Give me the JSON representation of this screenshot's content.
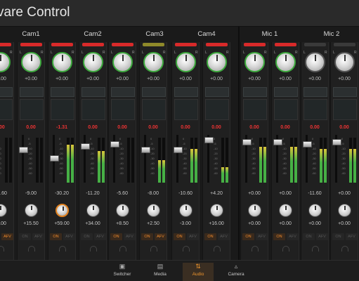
{
  "app": {
    "title": "vare Control"
  },
  "groups": [
    {
      "name": "Cam1"
    },
    {
      "name": "Cam2"
    },
    {
      "name": "Cam3"
    },
    {
      "name": "Cam4"
    },
    {
      "name": "Mic 1"
    },
    {
      "name": "Mic 2"
    }
  ],
  "strips": [
    {
      "tally": "red",
      "trim": "+0.00",
      "peak": "0.00",
      "gain": "-30.60",
      "balance": "+0.00",
      "on": "ON",
      "afv": "AFV",
      "on_active": true,
      "afv_active": true,
      "level": 0.0,
      "fader": 0.5
    },
    {
      "tally": "red",
      "trim": "+0.00",
      "peak": "0.00",
      "gain": "-9.00",
      "balance": "+15.50",
      "on": "ON",
      "afv": "AFV",
      "on_active": false,
      "afv_active": false,
      "level": 0.0,
      "fader": 0.7
    },
    {
      "tally": "red",
      "trim": "+0.00",
      "peak": "-1.31",
      "gain": "-30.20",
      "balance": "+59.00",
      "on": "ON",
      "afv": "AFV",
      "on_active": true,
      "afv_active": false,
      "level": 0.85,
      "fader": 0.5
    },
    {
      "tally": "red",
      "trim": "+0.00",
      "peak": "0.00",
      "gain": "-11.20",
      "balance": "+34.00",
      "on": "ON",
      "afv": "AFV",
      "on_active": false,
      "afv_active": false,
      "level": 0.7,
      "fader": 0.8
    },
    {
      "tally": "red",
      "trim": "+0.00",
      "peak": "0.00",
      "gain": "-5.60",
      "balance": "+8.50",
      "on": "ON",
      "afv": "AFV",
      "on_active": true,
      "afv_active": false,
      "level": 0.0,
      "fader": 0.85
    },
    {
      "tally": "yellow",
      "trim": "+0.00",
      "peak": "0.00",
      "gain": "-8.00",
      "balance": "+2.50",
      "on": "ON",
      "afv": "AFV",
      "on_active": true,
      "afv_active": true,
      "level": 0.5,
      "fader": 0.7
    },
    {
      "tally": "red",
      "trim": "+0.00",
      "peak": "0.00",
      "gain": "-10.60",
      "balance": "-3.00",
      "on": "ON",
      "afv": "AFV",
      "on_active": true,
      "afv_active": false,
      "level": 0.75,
      "fader": 0.7
    },
    {
      "tally": "red",
      "trim": "+0.00",
      "peak": "0.00",
      "gain": "+4.20",
      "balance": "+16.00",
      "on": "ON",
      "afv": "AFV",
      "on_active": true,
      "afv_active": false,
      "level": 0.35,
      "fader": 0.95
    },
    {
      "tally": "red",
      "trim": "+0.00",
      "peak": "0.00",
      "gain": "+0.00",
      "balance": "+0.00",
      "on": "ON",
      "afv": "AFV",
      "on_active": true,
      "afv_active": false,
      "level": 0.8,
      "fader": 0.9
    },
    {
      "tally": "red",
      "trim": "+0.00",
      "peak": "0.00",
      "gain": "+0.00",
      "balance": "+0.00",
      "on": "ON",
      "afv": "AFV",
      "on_active": true,
      "afv_active": false,
      "level": 0.8,
      "fader": 0.9
    },
    {
      "tally": "off",
      "trim": "+0.00",
      "peak": "0.00",
      "gain": "-11.60",
      "balance": "+0.00",
      "on": "ON",
      "afv": "AFV",
      "on_active": false,
      "afv_active": false,
      "level": 0.75,
      "fader": 0.85
    },
    {
      "tally": "off",
      "trim": "+0.00",
      "peak": "0.00",
      "gain": "+0.00",
      "balance": "+0.00",
      "on": "ON",
      "afv": "AFV",
      "on_active": false,
      "afv_active": false,
      "level": 0.75,
      "fader": 0.9
    }
  ],
  "tabs": [
    {
      "label": "Switcher",
      "icon": "switcher-icon",
      "selected": false
    },
    {
      "label": "Media",
      "icon": "media-icon",
      "selected": false
    },
    {
      "label": "Audio",
      "icon": "audio-icon",
      "selected": true
    },
    {
      "label": "Camera",
      "icon": "camera-icon",
      "selected": false
    }
  ],
  "colors": {
    "tally_red": "#d92a2a",
    "tally_yellow": "#8f8a2a",
    "tally_off": "#3a3a3a",
    "accent": "#f2972e"
  }
}
